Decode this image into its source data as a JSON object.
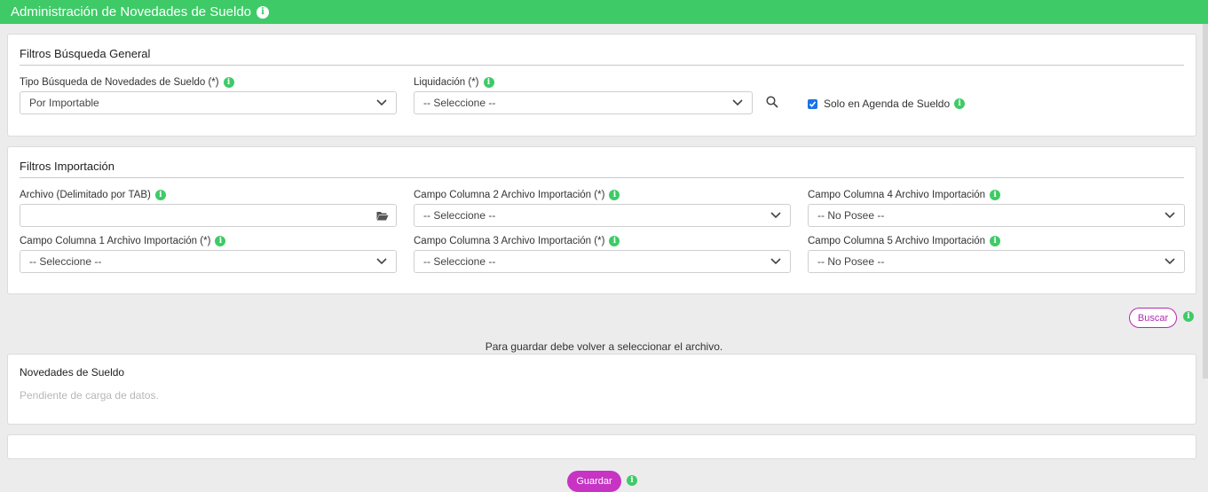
{
  "header": {
    "title": "Administración de Novedades de Sueldo",
    "info_icon": "info-icon"
  },
  "general_filters": {
    "title": "Filtros Búsqueda General",
    "tipo_busqueda": {
      "label": "Tipo Búsqueda de Novedades de Sueldo (*)",
      "value": "Por Importable"
    },
    "liquidacion": {
      "label": "Liquidación (*)",
      "value": "-- Seleccione --"
    },
    "search_icon": "search-icon",
    "solo_agenda": {
      "label": "Solo en Agenda de Sueldo",
      "checked": true
    }
  },
  "import_filters": {
    "title": "Filtros Importación",
    "archivo": {
      "label": "Archivo (Delimitado por TAB)",
      "value": ""
    },
    "campo1": {
      "label": "Campo Columna 1 Archivo Importación (*)",
      "value": "-- Seleccione --"
    },
    "campo2": {
      "label": "Campo Columna 2 Archivo Importación (*)",
      "value": "-- Seleccione --"
    },
    "campo3": {
      "label": "Campo Columna 3 Archivo Importación (*)",
      "value": "-- Seleccione --"
    },
    "campo4": {
      "label": "Campo Columna 4 Archivo Importación",
      "value": "-- No Posee --"
    },
    "campo5": {
      "label": "Campo Columna 5 Archivo Importación",
      "value": "-- No Posee --"
    }
  },
  "actions": {
    "buscar_label": "Buscar",
    "notice": "Para guardar debe volver a seleccionar el archivo.",
    "guardar_label": "Guardar"
  },
  "novedades": {
    "title": "Novedades de Sueldo",
    "status": "Pendiente de carga de datos."
  },
  "colors": {
    "header": "#3ecb67",
    "info": "#3ecb67",
    "accent": "#c734c4",
    "checkbox": "#1a73e8"
  }
}
